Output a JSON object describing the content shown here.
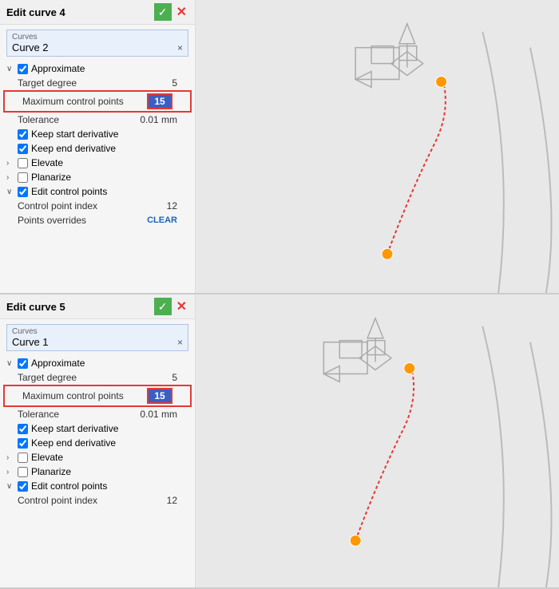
{
  "panels": [
    {
      "title": "Edit curve 4",
      "curves_label": "Curves",
      "curves_value": "Curve 2",
      "approximate_label": "Approximate",
      "target_degree_label": "Target degree",
      "target_degree_value": "5",
      "max_control_points_label": "Maximum control points",
      "max_control_points_value": "15",
      "tolerance_label": "Tolerance",
      "tolerance_value": "0.01 mm",
      "keep_start_label": "Keep start derivative",
      "keep_end_label": "Keep end derivative",
      "elevate_label": "Elevate",
      "planarize_label": "Planarize",
      "edit_control_points_label": "Edit control points",
      "control_point_index_label": "Control point index",
      "control_point_index_value": "12",
      "points_overrides_label": "Points overrides",
      "clear_label": "CLEAR",
      "check_icon": "✓",
      "close_icon": "✕"
    },
    {
      "title": "Edit curve 5",
      "curves_label": "Curves",
      "curves_value": "Curve 1",
      "approximate_label": "Approximate",
      "target_degree_label": "Target degree",
      "target_degree_value": "5",
      "max_control_points_label": "Maximum control points",
      "max_control_points_value": "15",
      "tolerance_label": "Tolerance",
      "tolerance_value": "0.01 mm",
      "keep_start_label": "Keep start derivative",
      "keep_end_label": "Keep end derivative",
      "elevate_label": "Elevate",
      "planarize_label": "Planarize",
      "edit_control_points_label": "Edit control points",
      "control_point_index_label": "Control point index",
      "control_point_index_value": "12",
      "check_icon": "✓",
      "close_icon": "✕"
    }
  ]
}
